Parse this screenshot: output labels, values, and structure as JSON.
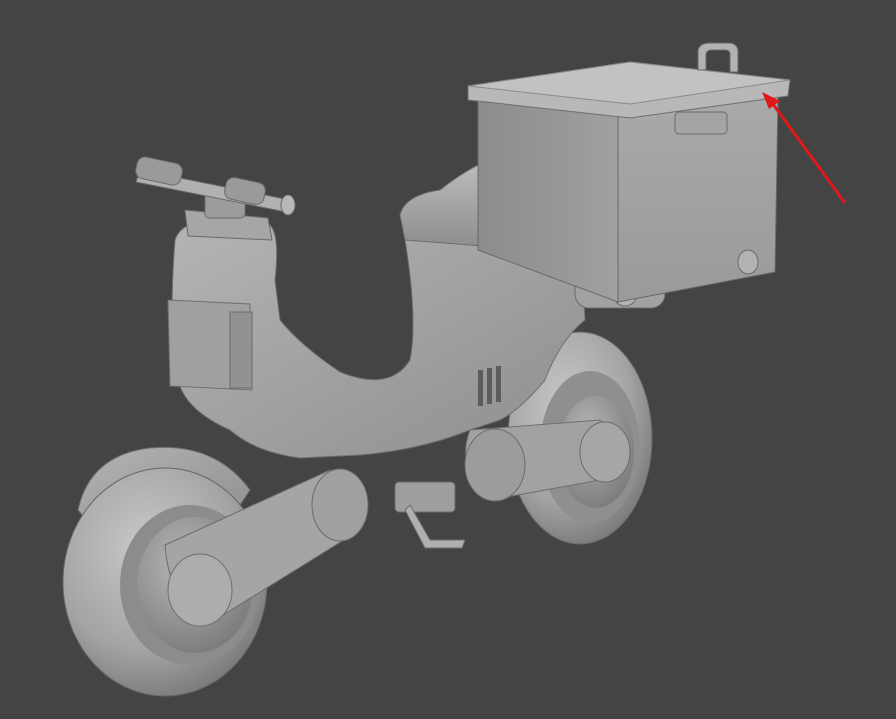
{
  "viewport": {
    "background_color": "#444444",
    "render_style": "solid grey clay shading"
  },
  "model": {
    "object": "scooter",
    "parts": [
      "handlebar",
      "front-fairing",
      "seat",
      "body",
      "cargo-box",
      "cargo-box-handle",
      "front-wheel",
      "rear-wheel",
      "fender",
      "swing-arm",
      "kickstand-pedal"
    ],
    "base_color": "#a6a6a6"
  },
  "annotation": {
    "type": "arrow",
    "color": "#e01818",
    "points_to": "cargo-box-lid-corner"
  }
}
